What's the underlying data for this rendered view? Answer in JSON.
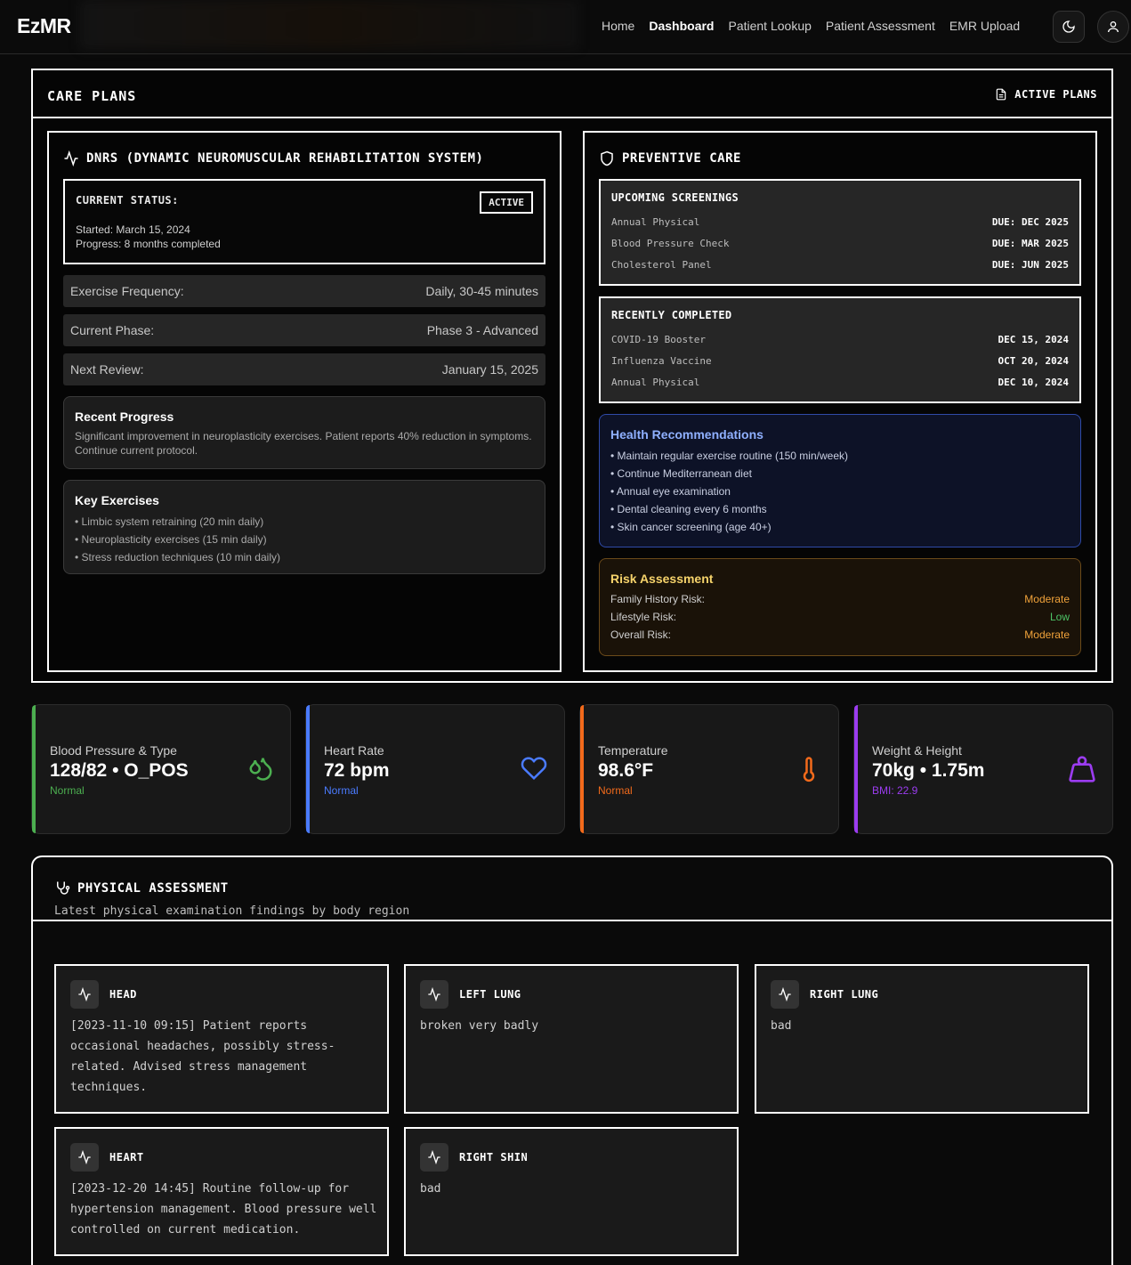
{
  "nav": {
    "logo": "EzMR",
    "links": [
      "Home",
      "Dashboard",
      "Patient Lookup",
      "Patient Assessment",
      "EMR Upload"
    ],
    "active": "Dashboard",
    "theme_icon": "moon-icon",
    "user_icon": "user-icon"
  },
  "care_plans": {
    "title": "CARE PLANS",
    "active_plans": "ACTIVE PLANS",
    "dnrs": {
      "title": "DNRS (DYNAMIC NEUROMUSCULAR REHABILITATION SYSTEM)",
      "status_label": "CURRENT STATUS:",
      "badge": "ACTIVE",
      "started": "Started: March 15, 2024",
      "progress": "Progress: 8 months completed",
      "rows": [
        {
          "label": "Exercise Frequency:",
          "value": "Daily, 30-45 minutes"
        },
        {
          "label": "Current Phase:",
          "value": "Phase 3 - Advanced"
        },
        {
          "label": "Next Review:",
          "value": "January 15, 2025"
        }
      ],
      "recent_progress": {
        "title": "Recent Progress",
        "text": "Significant improvement in neuroplasticity exercises. Patient reports 40% reduction in symptoms. Continue current protocol."
      },
      "key_exercises": {
        "title": "Key Exercises",
        "items": [
          "• Limbic system retraining (20 min daily)",
          "• Neuroplasticity exercises (15 min daily)",
          "• Stress reduction techniques (10 min daily)"
        ]
      }
    },
    "preventive": {
      "title": "PREVENTIVE CARE",
      "upcoming": {
        "title": "UPCOMING SCREENINGS",
        "rows": [
          {
            "label": "Annual Physical",
            "value": "DUE: DEC 2025"
          },
          {
            "label": "Blood Pressure Check",
            "value": "DUE: MAR 2025"
          },
          {
            "label": "Cholesterol Panel",
            "value": "DUE: JUN 2025"
          }
        ]
      },
      "completed": {
        "title": "RECENTLY COMPLETED",
        "rows": [
          {
            "label": "COVID-19 Booster",
            "value": "DEC 15, 2024"
          },
          {
            "label": "Influenza Vaccine",
            "value": "OCT 20, 2024"
          },
          {
            "label": "Annual Physical",
            "value": "DEC 10, 2024"
          }
        ]
      },
      "recommendations": {
        "title": "Health Recommendations",
        "items": [
          "• Maintain regular exercise routine (150 min/week)",
          "• Continue Mediterranean diet",
          "• Annual eye examination",
          "• Dental cleaning every 6 months",
          "• Skin cancer screening (age 40+)"
        ]
      },
      "risk": {
        "title": "Risk Assessment",
        "rows": [
          {
            "label": "Family History Risk:",
            "value": "Moderate",
            "color": "#f0a23a"
          },
          {
            "label": "Lifestyle Risk:",
            "value": "Low",
            "color": "#4cc466"
          },
          {
            "label": "Overall Risk:",
            "value": "Moderate",
            "color": "#f0a23a"
          }
        ]
      }
    }
  },
  "vitals": [
    {
      "label": "Blood Pressure & Type",
      "value": "128/82 • O_POS",
      "status": "Normal",
      "color": "#4caf50",
      "icon": "droplets-icon"
    },
    {
      "label": "Heart Rate",
      "value": "72 bpm",
      "status": "Normal",
      "color": "#4a7bff",
      "icon": "heart-icon"
    },
    {
      "label": "Temperature",
      "value": "98.6°F",
      "status": "Normal",
      "color": "#f26a1b",
      "icon": "thermometer-icon"
    },
    {
      "label": "Weight & Height",
      "value": "70kg • 1.75m",
      "status": "BMI: 22.9",
      "color": "#9b3cf0",
      "icon": "weight-icon"
    }
  ],
  "physical": {
    "title": "PHYSICAL ASSESSMENT",
    "subtitle": "Latest physical examination findings by body region",
    "regions": [
      {
        "name": "HEAD",
        "text": "[2023-11-10 09:15] Patient reports occasional headaches, possibly stress-related. Advised stress management techniques."
      },
      {
        "name": "LEFT LUNG",
        "text": "broken very badly"
      },
      {
        "name": "RIGHT LUNG",
        "text": "bad"
      },
      {
        "name": "HEART",
        "text": "[2023-12-20 14:45] Routine follow-up for hypertension management. Blood pressure well controlled on current medication."
      },
      {
        "name": "RIGHT SHIN",
        "text": "bad"
      }
    ]
  }
}
